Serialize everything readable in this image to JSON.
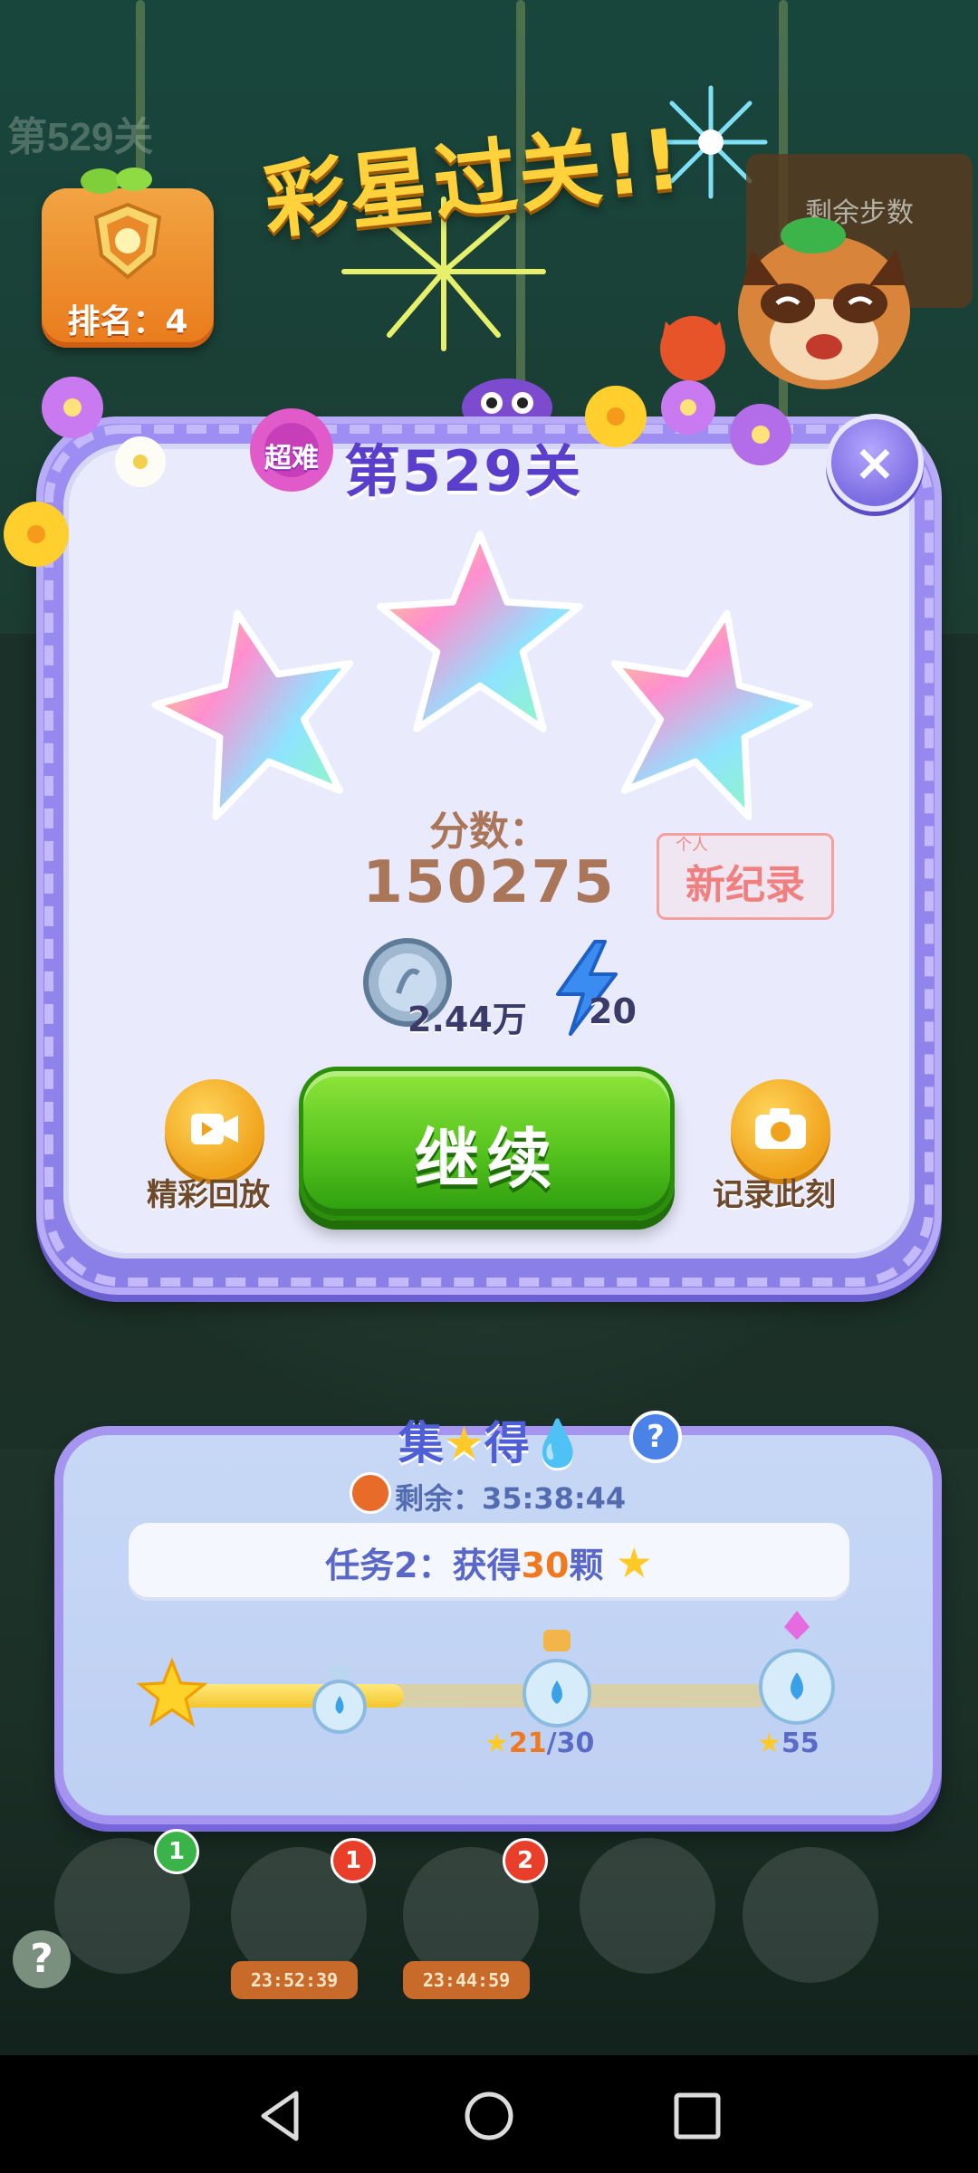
{
  "background": {
    "level_header": "第529关"
  },
  "rank": {
    "label": "排名：4"
  },
  "banner": {
    "title": "彩星过关!!"
  },
  "side_board": {
    "label": "剩余步数"
  },
  "level": {
    "difficulty": "超难",
    "title": "第529关"
  },
  "stars": {
    "earned": 3,
    "total": 3
  },
  "score": {
    "label": "分数：",
    "value": "150275",
    "record_small": "个人",
    "record_label": "新纪录"
  },
  "rewards": {
    "coins": "2.44万",
    "energy": "20"
  },
  "buttons": {
    "continue": "继续",
    "replay": "精彩回放",
    "capture": "记录此刻"
  },
  "collect": {
    "title": "集",
    "title_suffix": "得",
    "help": "?",
    "timer": "剩余：35:38:44",
    "task_prefix": "任务2：获得",
    "task_count": "30",
    "task_suffix": "颗",
    "progress_current": "21",
    "progress_target": "/30",
    "final_target": "55",
    "progress_fraction": 0.4
  },
  "boosters": [
    {
      "badge": "1",
      "time": ""
    },
    {
      "badge": "1",
      "time": "23:52:39"
    },
    {
      "badge": "2",
      "time": "23:44:59"
    }
  ],
  "help_icon": "?"
}
